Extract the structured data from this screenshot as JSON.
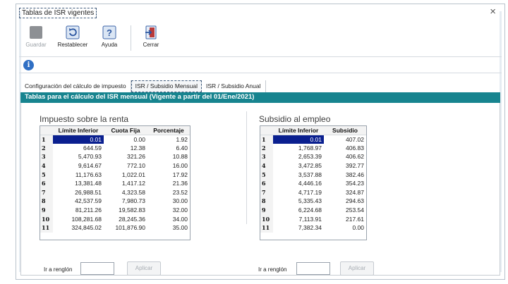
{
  "window": {
    "title": "Tablas de ISR vigentes",
    "close_label": "×"
  },
  "toolbar": {
    "save_label": "Guardar",
    "reset_label": "Restablecer",
    "help_label": "Ayuda",
    "close_label": "Cerrar"
  },
  "tabs": [
    {
      "label": "Configuración del cálculo de impuesto"
    },
    {
      "label": "ISR / Subsidio Mensual"
    },
    {
      "label": "ISR / Subsidio Anual"
    }
  ],
  "panel": {
    "header": "Tablas para el cálculo del ISR mensual (Vigente a partir del 01/Ene/2021)"
  },
  "isr": {
    "title": "Impuesto sobre la renta",
    "columns": [
      "Límite Inferior",
      "Cuota Fija",
      "Porcentaje"
    ],
    "rows": [
      [
        "1",
        "0.01",
        "0.00",
        "1.92"
      ],
      [
        "2",
        "644.59",
        "12.38",
        "6.40"
      ],
      [
        "3",
        "5,470.93",
        "321.26",
        "10.88"
      ],
      [
        "4",
        "9,614.67",
        "772.10",
        "16.00"
      ],
      [
        "5",
        "11,176.63",
        "1,022.01",
        "17.92"
      ],
      [
        "6",
        "13,381.48",
        "1,417.12",
        "21.36"
      ],
      [
        "7",
        "26,988.51",
        "4,323.58",
        "23.52"
      ],
      [
        "8",
        "42,537.59",
        "7,980.73",
        "30.00"
      ],
      [
        "9",
        "81,211.26",
        "19,582.83",
        "32.00"
      ],
      [
        "10",
        "108,281.68",
        "28,245.36",
        "34.00"
      ],
      [
        "11",
        "324,845.02",
        "101,876.90",
        "35.00"
      ]
    ],
    "goto_label": "Ir a renglón",
    "apply_label": "Aplicar"
  },
  "subsidio": {
    "title": "Subsidio al empleo",
    "columns": [
      "Límite Inferior",
      "Subsidio"
    ],
    "rows": [
      [
        "1",
        "0.01",
        "407.02"
      ],
      [
        "2",
        "1,768.97",
        "406.83"
      ],
      [
        "3",
        "2,653.39",
        "406.62"
      ],
      [
        "4",
        "3,472.85",
        "392.77"
      ],
      [
        "5",
        "3,537.88",
        "382.46"
      ],
      [
        "6",
        "4,446.16",
        "354.23"
      ],
      [
        "7",
        "4,717.19",
        "324.87"
      ],
      [
        "8",
        "5,335.43",
        "294.63"
      ],
      [
        "9",
        "6,224.68",
        "253.54"
      ],
      [
        "10",
        "7,113.91",
        "217.61"
      ],
      [
        "11",
        "7,382.34",
        "0.00"
      ]
    ],
    "goto_label": "Ir a renglón",
    "apply_label": "Aplicar"
  },
  "icons": {
    "save": "save-icon",
    "reset": "reset-icon",
    "help": "help-icon",
    "close": "exit-icon",
    "info": "info-icon"
  }
}
